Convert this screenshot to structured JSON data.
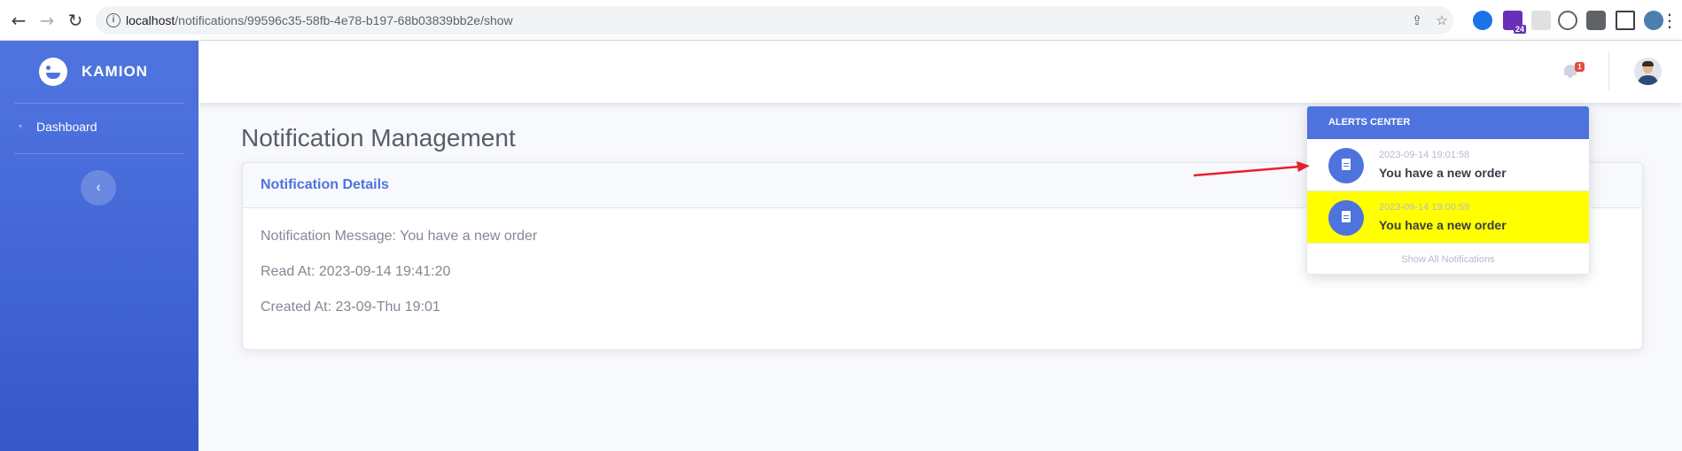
{
  "browser": {
    "url_host": "localhost",
    "url_path": "/notifications/99596c35-58fb-4e78-b197-68b03839bb2e/show",
    "extension_badge": "24"
  },
  "sidebar": {
    "brand": "KAMION",
    "items": [
      {
        "label": "Dashboard",
        "icon": "tachometer-icon"
      }
    ],
    "toggle_icon": "chevron-left-icon"
  },
  "topbar": {
    "alert_count": "1"
  },
  "main": {
    "page_title": "Notification Management",
    "card_title": "Notification Details",
    "details": [
      "Notification Message: You have a new order",
      "Read At: 2023-09-14 19:41:20",
      "Created At: 23-09-Thu 19:01"
    ]
  },
  "alerts": {
    "header": "ALERTS CENTER",
    "items": [
      {
        "date": "2023-09-14 19:01:58",
        "text": "You have a new order",
        "highlighted": false
      },
      {
        "date": "2023-09-14 19:00:59",
        "text": "You have a new order",
        "highlighted": true
      }
    ],
    "footer": "Show All Notifications"
  },
  "colors": {
    "primary": "#4e73df",
    "highlight": "#ffff00",
    "badge": "#e74a3b",
    "annotation_arrow": "#e8202a"
  }
}
